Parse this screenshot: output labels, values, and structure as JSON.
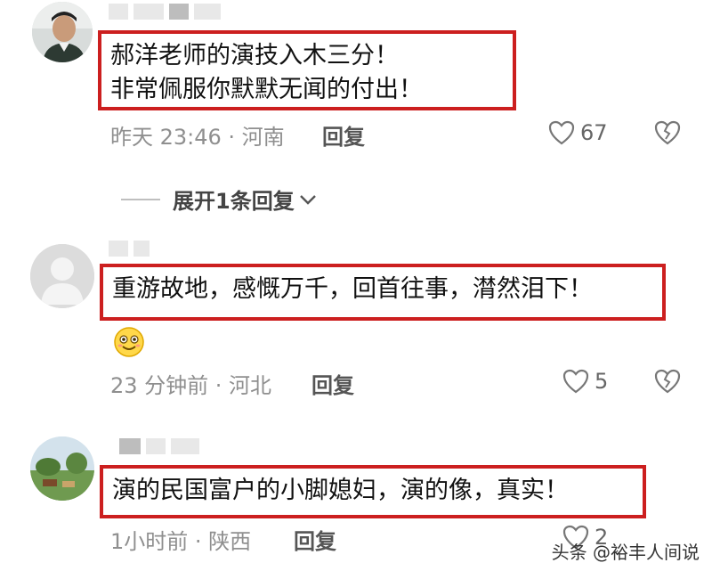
{
  "comments": [
    {
      "lines": [
        "郝洋老师的演技入木三分！",
        "非常佩服你默默无闻的付出！"
      ],
      "time": "昨天 23:46 · 河南",
      "reply_label": "回复",
      "likes": "67",
      "expand_label": "展开1条回复"
    },
    {
      "lines": [
        "重游故地，感慨万千，回首往事，潸然泪下！"
      ],
      "time": "23 分钟前 · 河北",
      "reply_label": "回复",
      "likes": "5"
    },
    {
      "lines": [
        "演的民国富户的小脚媳妇，演的像，真实！"
      ],
      "time": "1小时前 · 陕西",
      "reply_label": "回复",
      "likes": "2"
    }
  ],
  "watermark": "头条 @裕丰人间说",
  "icons": {
    "like": "heart-outline-icon",
    "dislike": "broken-heart-icon",
    "expand": "chevron-down-icon",
    "emoji": "smiling-face-icon"
  },
  "colors": {
    "highlight_border": "#cc1f1f",
    "meta_text": "#8f8f8f"
  }
}
